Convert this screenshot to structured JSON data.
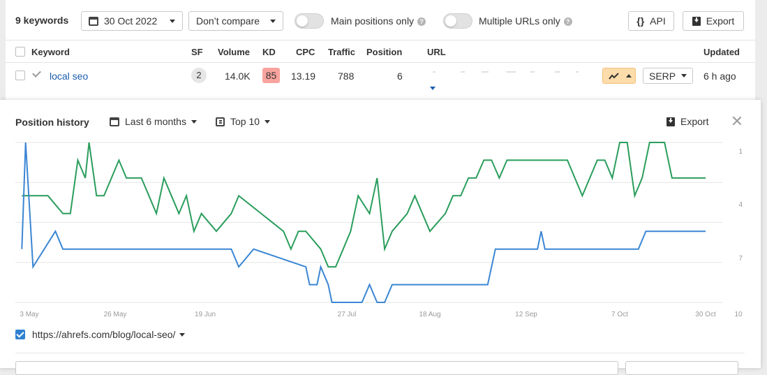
{
  "toolbar": {
    "keyword_count": "9 keywords",
    "date": "30 Oct 2022",
    "compare": "Don’t compare",
    "main_positions": "Main positions only",
    "multiple_urls": "Multiple URLs only",
    "api": "API",
    "export": "Export"
  },
  "table": {
    "headers": {
      "keyword": "Keyword",
      "sf": "SF",
      "volume": "Volume",
      "kd": "KD",
      "cpc": "CPC",
      "traffic": "Traffic",
      "position": "Position",
      "url": "URL",
      "updated": "Updated"
    },
    "row": {
      "keyword": "local seo",
      "sf": "2",
      "volume": "14.0K",
      "kd": "85",
      "cpc": "13.19",
      "traffic": "788",
      "position": "6",
      "serp": "SERP",
      "updated": "6 h ago"
    }
  },
  "panel": {
    "title": "Position history",
    "range": "Last 6 months",
    "top": "Top 10",
    "export": "Export",
    "legend_url": "https://ahrefs.com/blog/local-seo/"
  },
  "colors": {
    "green_series": "#2a9d5c",
    "blue_series": "#3a86d4",
    "kd_badge": "#f8a39d",
    "link": "#1a5cab"
  },
  "chart_data": {
    "type": "line",
    "x_tick_labels": [
      "3 May",
      "26 May",
      "19 Jun",
      "27 Jul",
      "18 Aug",
      "12 Sep",
      "7 Oct",
      "30 Oct"
    ],
    "y_tick_labels": [
      "1",
      "4",
      "7",
      "10"
    ],
    "ylim": [
      0,
      10
    ],
    "y_inverted": true,
    "grid": true,
    "series": [
      {
        "color": "#2a9d5c",
        "x": [
          "2022-05-01",
          "2022-05-08",
          "2022-05-12",
          "2022-05-14",
          "2022-05-16",
          "2022-05-18",
          "2022-05-19",
          "2022-05-21",
          "2022-05-23",
          "2022-05-25",
          "2022-05-27",
          "2022-05-29",
          "2022-06-02",
          "2022-06-04",
          "2022-06-06",
          "2022-06-08",
          "2022-06-10",
          "2022-06-12",
          "2022-06-14",
          "2022-06-16",
          "2022-06-18",
          "2022-06-22",
          "2022-06-26",
          "2022-06-28",
          "2022-07-10",
          "2022-07-12",
          "2022-07-14",
          "2022-07-16",
          "2022-07-20",
          "2022-07-22",
          "2022-07-24",
          "2022-07-26",
          "2022-07-28",
          "2022-07-30",
          "2022-08-02",
          "2022-08-04",
          "2022-08-06",
          "2022-08-08",
          "2022-08-12",
          "2022-08-14",
          "2022-08-18",
          "2022-08-22",
          "2022-08-24",
          "2022-08-26",
          "2022-08-28",
          "2022-08-30",
          "2022-09-01",
          "2022-09-03",
          "2022-09-05",
          "2022-09-07",
          "2022-09-09",
          "2022-09-11",
          "2022-09-23",
          "2022-09-25",
          "2022-09-27",
          "2022-09-29",
          "2022-10-01",
          "2022-10-03",
          "2022-10-05",
          "2022-10-07",
          "2022-10-09",
          "2022-10-11",
          "2022-10-13",
          "2022-10-15",
          "2022-10-19",
          "2022-10-21",
          "2022-10-23",
          "2022-10-30"
        ],
        "y": [
          4,
          4,
          5,
          5,
          2,
          3,
          1,
          4,
          4,
          3,
          2,
          3,
          3,
          4,
          5,
          3,
          4,
          5,
          4,
          6,
          5,
          6,
          5,
          4,
          6,
          7,
          6,
          6,
          7,
          8,
          8,
          7,
          6,
          4,
          5,
          3,
          7,
          6,
          5,
          4,
          6,
          5,
          4,
          4,
          3,
          3,
          2,
          2,
          3,
          2,
          2,
          2,
          2,
          3,
          4,
          3,
          2,
          2,
          3,
          1,
          1,
          4,
          3,
          1,
          1,
          3,
          3,
          3
        ]
      },
      {
        "color": "#3a86d4",
        "x": [
          "2022-05-01",
          "2022-05-02",
          "2022-05-04",
          "2022-05-07",
          "2022-05-10",
          "2022-05-12",
          "2022-06-26",
          "2022-06-28",
          "2022-07-02",
          "2022-07-16",
          "2022-07-17",
          "2022-07-19",
          "2022-07-20",
          "2022-07-22",
          "2022-07-23",
          "2022-07-25",
          "2022-07-31",
          "2022-08-02",
          "2022-08-04",
          "2022-08-06",
          "2022-08-08",
          "2022-09-02",
          "2022-09-04",
          "2022-09-15",
          "2022-09-16",
          "2022-09-17",
          "2022-10-11",
          "2022-10-12",
          "2022-10-14",
          "2022-10-30"
        ],
        "y": [
          7,
          1,
          8,
          7,
          6,
          7,
          7,
          8,
          7,
          8,
          9,
          9,
          8,
          9,
          10,
          10,
          10,
          9,
          10,
          10,
          9,
          9,
          7,
          7,
          6,
          7,
          7,
          7,
          6,
          6
        ]
      }
    ]
  }
}
